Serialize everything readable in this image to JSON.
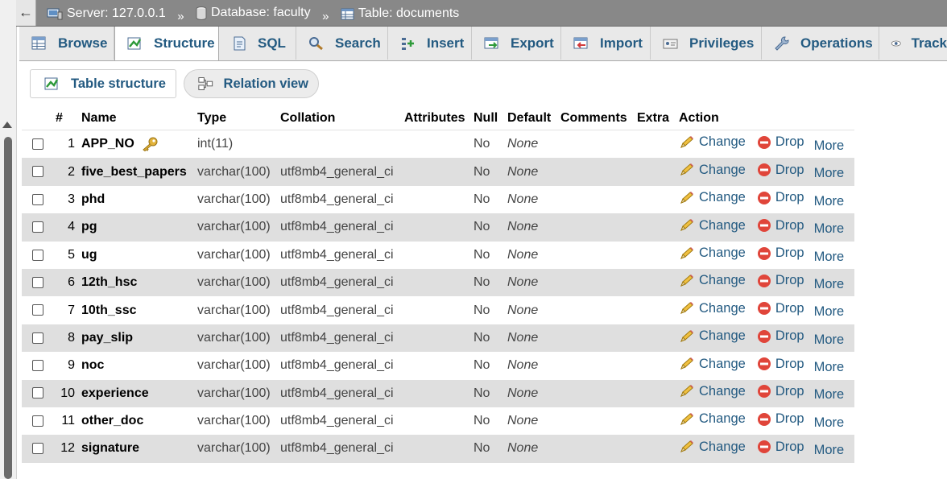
{
  "breadcrumb": {
    "back_glyph": "←",
    "server": "Server: 127.0.0.1",
    "database": "Database: faculty",
    "table": "Table: documents",
    "separator": "»"
  },
  "tabs": [
    {
      "label": "Browse",
      "icon": "browse-icon",
      "active": false
    },
    {
      "label": "Structure",
      "icon": "structure-icon",
      "active": true
    },
    {
      "label": "SQL",
      "icon": "sql-icon",
      "active": false
    },
    {
      "label": "Search",
      "icon": "search-icon",
      "active": false
    },
    {
      "label": "Insert",
      "icon": "insert-icon",
      "active": false
    },
    {
      "label": "Export",
      "icon": "export-icon",
      "active": false
    },
    {
      "label": "Import",
      "icon": "import-icon",
      "active": false
    },
    {
      "label": "Privileges",
      "icon": "privileges-icon",
      "active": false
    },
    {
      "label": "Operations",
      "icon": "operations-icon",
      "active": false
    },
    {
      "label": "Track",
      "icon": "tracking-icon",
      "active": false
    }
  ],
  "subtabs": {
    "table_structure": "Table structure",
    "relation_view": "Relation view"
  },
  "columns": {
    "num": "#",
    "name": "Name",
    "type": "Type",
    "collation": "Collation",
    "attributes": "Attributes",
    "null": "Null",
    "default": "Default",
    "comments": "Comments",
    "extra": "Extra",
    "action": "Action"
  },
  "actions": {
    "change": "Change",
    "drop": "Drop",
    "more": "More"
  },
  "rows": [
    {
      "num": "1",
      "name": "APP_NO",
      "primary_key": true,
      "type": "int(11)",
      "collation": "",
      "null": "No",
      "default": "None"
    },
    {
      "num": "2",
      "name": "five_best_papers",
      "type": "varchar(100)",
      "collation": "utf8mb4_general_ci",
      "null": "No",
      "default": "None"
    },
    {
      "num": "3",
      "name": "phd",
      "type": "varchar(100)",
      "collation": "utf8mb4_general_ci",
      "null": "No",
      "default": "None"
    },
    {
      "num": "4",
      "name": "pg",
      "type": "varchar(100)",
      "collation": "utf8mb4_general_ci",
      "null": "No",
      "default": "None"
    },
    {
      "num": "5",
      "name": "ug",
      "type": "varchar(100)",
      "collation": "utf8mb4_general_ci",
      "null": "No",
      "default": "None"
    },
    {
      "num": "6",
      "name": "12th_hsc",
      "type": "varchar(100)",
      "collation": "utf8mb4_general_ci",
      "null": "No",
      "default": "None"
    },
    {
      "num": "7",
      "name": "10th_ssc",
      "type": "varchar(100)",
      "collation": "utf8mb4_general_ci",
      "null": "No",
      "default": "None"
    },
    {
      "num": "8",
      "name": "pay_slip",
      "type": "varchar(100)",
      "collation": "utf8mb4_general_ci",
      "null": "No",
      "default": "None"
    },
    {
      "num": "9",
      "name": "noc",
      "type": "varchar(100)",
      "collation": "utf8mb4_general_ci",
      "null": "No",
      "default": "None"
    },
    {
      "num": "10",
      "name": "experience",
      "type": "varchar(100)",
      "collation": "utf8mb4_general_ci",
      "null": "No",
      "default": "None"
    },
    {
      "num": "11",
      "name": "other_doc",
      "type": "varchar(100)",
      "collation": "utf8mb4_general_ci",
      "null": "No",
      "default": "None"
    },
    {
      "num": "12",
      "name": "signature",
      "type": "varchar(100)",
      "collation": "utf8mb4_general_ci",
      "null": "No",
      "default": "None"
    }
  ],
  "colors": {
    "link": "#235a81",
    "topbar": "#888888",
    "row_alt": "#dfdfdf",
    "drop_icon": "#e0453a",
    "key_icon": "#d6a21e"
  }
}
